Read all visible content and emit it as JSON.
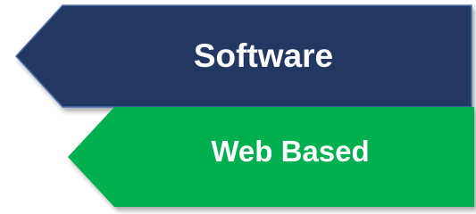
{
  "shapes": [
    {
      "name": "software",
      "label": "Software",
      "fill": "#213864",
      "stroke": "#4a6fb0"
    },
    {
      "name": "web-based",
      "label": "Web Based",
      "fill": "#00b050"
    }
  ],
  "colors": {
    "text": "#ffffff",
    "shadow": "#9a9a9a"
  }
}
